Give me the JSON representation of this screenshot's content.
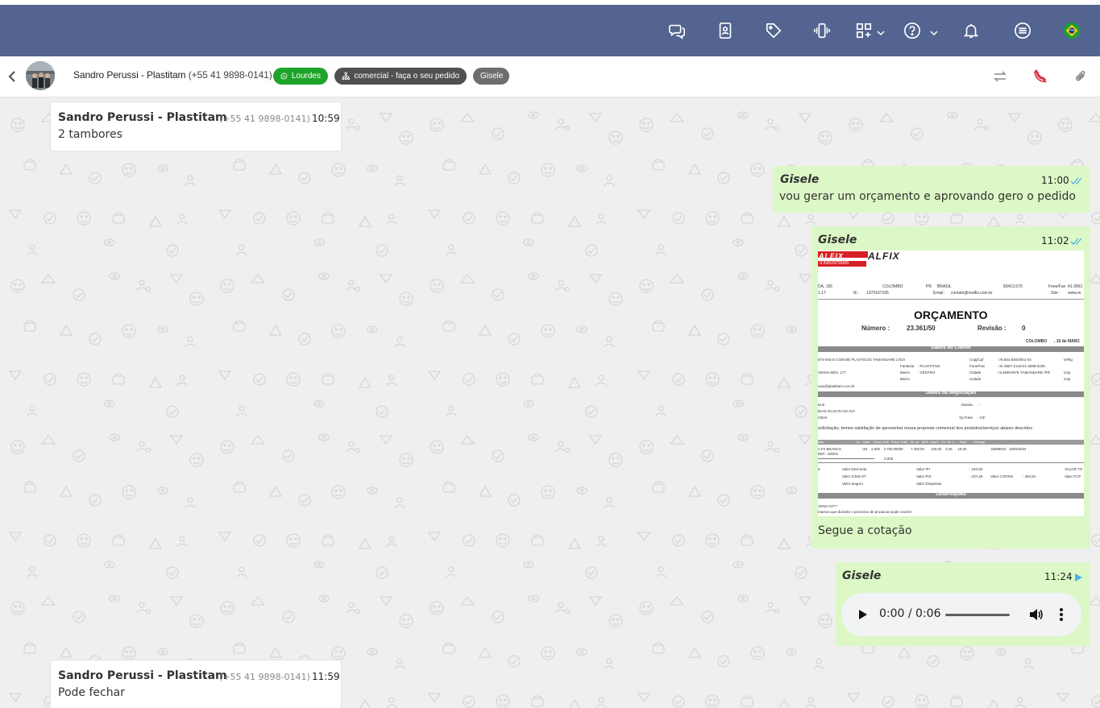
{
  "topbar": {
    "icons": [
      "chat-bubbles-icon",
      "contact-book-icon",
      "tag-icon",
      "phone-ring-icon",
      "apps-grid-icon",
      "help-icon",
      "bell-icon",
      "menu-list-icon",
      "brazil-flag-icon"
    ],
    "bg_color": "#52648f"
  },
  "chat_header": {
    "contact_name": "Sandro Perussi - Plastitam",
    "contact_phone": "(+55 41 9898-0141)",
    "tags": {
      "channel": "Lourdes",
      "queue": "comercial - faça o seu pedido",
      "user": "Gisele"
    }
  },
  "messages": [
    {
      "direction": "in",
      "sender": "Sandro Perussi - Plastitam",
      "phone": "(+55 41 9898-0141)",
      "time": "10:59",
      "text": "2 tambores"
    },
    {
      "direction": "out",
      "sender": "Gisele",
      "time": "11:00",
      "status": "read",
      "text": "vou gerar um orçamento e aprovando gero o pedido"
    },
    {
      "direction": "out",
      "sender": "Gisele",
      "time": "11:02",
      "status": "read",
      "caption": "Segue a cotação",
      "document": {
        "logo": "ALFIX",
        "logo_sub": "S INDUSTRIAIS",
        "addr_line1": "DA, 165",
        "city": "COLOMBO",
        "state": "PR",
        "country": "BRASIL",
        "cep": "83413.570",
        "fone_label": "Fone/Fax :",
        "fone_value": "41-3661",
        "ie_line": "1.17",
        "ie_label": "IE :",
        "ie_value": "1370167105",
        "email_label": "Email :",
        "email_value": "contato@realfix.com.br",
        "site_label": "Site :",
        "site_value": "www.re",
        "title": "ORÇAMENTO",
        "numero_label": "Número :",
        "numero_value": "23.361/50",
        "revisao_label": "Revisão :",
        "revisao_value": "0",
        "date_city": "COLOMBO",
        "date_value": ", 15 de MARC",
        "section_client": "Dados do Cliente",
        "client_name": "874-IND E COM DE PLASTICOS TAMANDARE LTDA",
        "cnpj_label": "Cnpj/Cpf",
        "cnpj_value": ": 76.684.935/0001-04",
        "ierg_label": "Ie/Rg",
        "fantasia_label": "Fantasia",
        "fantasia_value": ": PLASTITAM",
        "fonefax_label": "Fone/Fax",
        "fonefax_value": ": 41-3657-2142/41-3698-0236",
        "street": "VESSA BINI, 177",
        "bairro_label": "Bairro",
        "bairro_value": ": CENTRO",
        "cidade_label": "Cidade",
        "cidade_value": ": ALMIRANTE TAMANDARE /PR",
        "cep_label": "Cep",
        "bairro2_label": "Bairro",
        "cidade2_label": "Cidade",
        "cep2_label": "Cep",
        "client_email": "vaio@plastitam.com.br",
        "section_negotiation": "Dados da Negociação",
        "neg_contact": "ELE",
        "moeda_label": "Moeda",
        "moeda_value": ": -",
        "neg_payment": "DIAS DA DATA DA N.F.",
        "neg_date": "/2024",
        "frete_label": "Tp.Frete",
        "frete_value": ": CIF",
        "intro": "solicitação, temos satisfação de apresentar nossa proposta comercial dos produtos/serviços abaixo descritos",
        "table_header": "ição                                    Un   Qtde    Preço Unit   Preço Total   Vlr. Ipi   Ipi%   Aliq%   Vlr. Ub. L.     Ncm        Entrega",
        "item_line1": "A FX BRANCO                      UN    2.000    3.700.00000        7.400.00       240.50    3.25      19.00                         32089010   18/03/2024",
        "item_line2": "REF.: 200KG",
        "item_total_qty": "2.000",
        "t_valor_desconto": "Valor Desconto",
        "t_valor_ipi": "Valor IPI",
        "t_valor_ipi_value": ": 240,50",
        "t_valor_total": "VALOR TO",
        "t_icms": "Valor ICMS-ST",
        "t_pis": "Valor PIS",
        "t_pis_value": ": 107,45",
        "t_cofins": "Valor COFINS",
        "t_cofins_value": ": 494,91",
        "t_fcp": "Valor FCP",
        "t_seguro": "Valor Seguro",
        "t_despesas": "Valor Despesas",
        "section_obs": "Observações",
        "obs1": "VENCAO***",
        "obs2": "mamos que durante o processo de producao pode ocorrer",
        "left_digit": "6"
      }
    },
    {
      "direction": "out",
      "sender": "Gisele",
      "time": "11:24",
      "status": "sent",
      "audio": {
        "time_display": "0:00 / 0:06",
        "progress": 0
      }
    },
    {
      "direction": "in",
      "sender": "Sandro Perussi - Plastitam",
      "phone": "(+55 41 9898-0141)",
      "time": "11:59",
      "text": "Pode fechar"
    }
  ],
  "colors": {
    "incoming_bg": "#ffffff",
    "outgoing_bg": "#dcf8c6",
    "chat_bg": "#efefef",
    "read_check": "#4fb3e8",
    "tag_whatsapp": "#1fa42a",
    "tag_queue": "#505050",
    "tag_user": "#6e6e6e"
  }
}
